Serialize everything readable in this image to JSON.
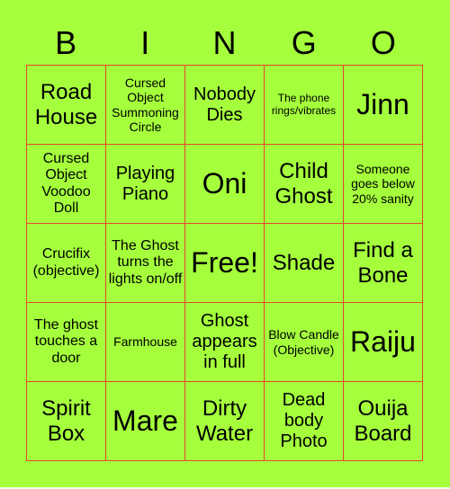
{
  "card": {
    "background_color": "#a5ff3c",
    "grid_line_color": "#e8452c",
    "header": [
      "B",
      "I",
      "N",
      "G",
      "O"
    ],
    "cells": [
      [
        "Road House",
        "Cursed Object Summoning Circle",
        "Nobody Dies",
        "The phone rings/vibrates",
        "Jinn"
      ],
      [
        "Cursed Object Voodoo Doll",
        "Playing Piano",
        "Oni",
        "Child Ghost",
        "Someone goes below 20% sanity"
      ],
      [
        "Crucifix (objective)",
        "The Ghost turns the lights on/off",
        "Free!",
        "Shade",
        "Find a Bone"
      ],
      [
        "The ghost touches a door",
        "Farmhouse",
        "Ghost appears in full",
        "Blow Candle (Objective)",
        "Raiju"
      ],
      [
        "Spirit Box",
        "Mare",
        "Dirty Water",
        "Dead body Photo",
        "Ouija Board"
      ]
    ]
  }
}
